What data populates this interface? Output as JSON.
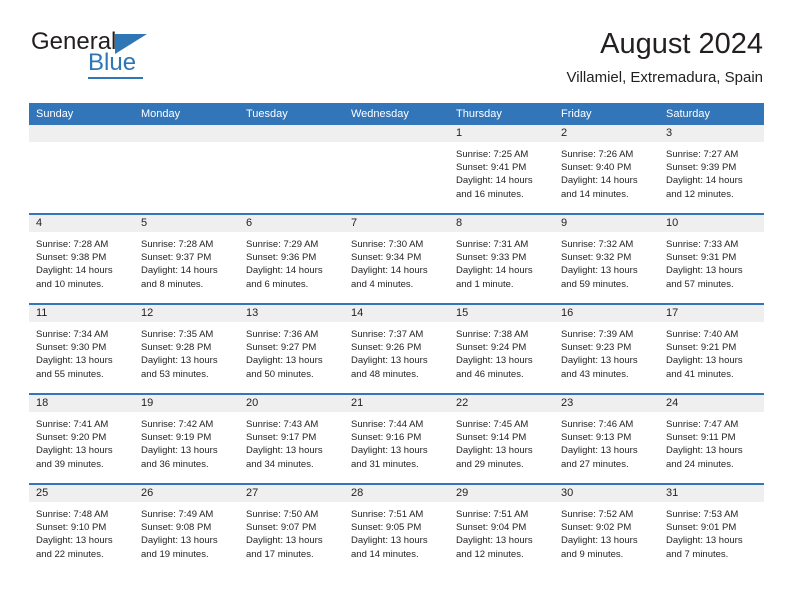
{
  "logo": {
    "word_top": "General",
    "word_bottom": "Blue",
    "brand_color": "#2f76b6",
    "triangle_icon": "triangle-icon"
  },
  "header": {
    "title": "August 2024",
    "subtitle": "Villamiel, Extremadura, Spain"
  },
  "theme": {
    "header_blue": "#3275b8",
    "daynum_gray": "#efefef",
    "text": "#231f20"
  },
  "weekday_headers": [
    "Sunday",
    "Monday",
    "Tuesday",
    "Wednesday",
    "Thursday",
    "Friday",
    "Saturday"
  ],
  "labels": {
    "sunrise": "Sunrise:",
    "sunset": "Sunset:",
    "daylight": "Daylight:"
  },
  "weeks": [
    [
      {
        "day": "",
        "blank": true,
        "sunrise": "",
        "sunset": "",
        "daylight_1": "",
        "daylight_2": ""
      },
      {
        "day": "",
        "blank": true,
        "sunrise": "",
        "sunset": "",
        "daylight_1": "",
        "daylight_2": ""
      },
      {
        "day": "",
        "blank": true,
        "sunrise": "",
        "sunset": "",
        "daylight_1": "",
        "daylight_2": ""
      },
      {
        "day": "",
        "blank": true,
        "sunrise": "",
        "sunset": "",
        "daylight_1": "",
        "daylight_2": ""
      },
      {
        "day": "1",
        "blank": false,
        "sunrise": "Sunrise: 7:25 AM",
        "sunset": "Sunset: 9:41 PM",
        "daylight_1": "Daylight: 14 hours",
        "daylight_2": "and 16 minutes."
      },
      {
        "day": "2",
        "blank": false,
        "sunrise": "Sunrise: 7:26 AM",
        "sunset": "Sunset: 9:40 PM",
        "daylight_1": "Daylight: 14 hours",
        "daylight_2": "and 14 minutes."
      },
      {
        "day": "3",
        "blank": false,
        "sunrise": "Sunrise: 7:27 AM",
        "sunset": "Sunset: 9:39 PM",
        "daylight_1": "Daylight: 14 hours",
        "daylight_2": "and 12 minutes."
      }
    ],
    [
      {
        "day": "4",
        "blank": false,
        "sunrise": "Sunrise: 7:28 AM",
        "sunset": "Sunset: 9:38 PM",
        "daylight_1": "Daylight: 14 hours",
        "daylight_2": "and 10 minutes."
      },
      {
        "day": "5",
        "blank": false,
        "sunrise": "Sunrise: 7:28 AM",
        "sunset": "Sunset: 9:37 PM",
        "daylight_1": "Daylight: 14 hours",
        "daylight_2": "and 8 minutes."
      },
      {
        "day": "6",
        "blank": false,
        "sunrise": "Sunrise: 7:29 AM",
        "sunset": "Sunset: 9:36 PM",
        "daylight_1": "Daylight: 14 hours",
        "daylight_2": "and 6 minutes."
      },
      {
        "day": "7",
        "blank": false,
        "sunrise": "Sunrise: 7:30 AM",
        "sunset": "Sunset: 9:34 PM",
        "daylight_1": "Daylight: 14 hours",
        "daylight_2": "and 4 minutes."
      },
      {
        "day": "8",
        "blank": false,
        "sunrise": "Sunrise: 7:31 AM",
        "sunset": "Sunset: 9:33 PM",
        "daylight_1": "Daylight: 14 hours",
        "daylight_2": "and 1 minute."
      },
      {
        "day": "9",
        "blank": false,
        "sunrise": "Sunrise: 7:32 AM",
        "sunset": "Sunset: 9:32 PM",
        "daylight_1": "Daylight: 13 hours",
        "daylight_2": "and 59 minutes."
      },
      {
        "day": "10",
        "blank": false,
        "sunrise": "Sunrise: 7:33 AM",
        "sunset": "Sunset: 9:31 PM",
        "daylight_1": "Daylight: 13 hours",
        "daylight_2": "and 57 minutes."
      }
    ],
    [
      {
        "day": "11",
        "blank": false,
        "sunrise": "Sunrise: 7:34 AM",
        "sunset": "Sunset: 9:30 PM",
        "daylight_1": "Daylight: 13 hours",
        "daylight_2": "and 55 minutes."
      },
      {
        "day": "12",
        "blank": false,
        "sunrise": "Sunrise: 7:35 AM",
        "sunset": "Sunset: 9:28 PM",
        "daylight_1": "Daylight: 13 hours",
        "daylight_2": "and 53 minutes."
      },
      {
        "day": "13",
        "blank": false,
        "sunrise": "Sunrise: 7:36 AM",
        "sunset": "Sunset: 9:27 PM",
        "daylight_1": "Daylight: 13 hours",
        "daylight_2": "and 50 minutes."
      },
      {
        "day": "14",
        "blank": false,
        "sunrise": "Sunrise: 7:37 AM",
        "sunset": "Sunset: 9:26 PM",
        "daylight_1": "Daylight: 13 hours",
        "daylight_2": "and 48 minutes."
      },
      {
        "day": "15",
        "blank": false,
        "sunrise": "Sunrise: 7:38 AM",
        "sunset": "Sunset: 9:24 PM",
        "daylight_1": "Daylight: 13 hours",
        "daylight_2": "and 46 minutes."
      },
      {
        "day": "16",
        "blank": false,
        "sunrise": "Sunrise: 7:39 AM",
        "sunset": "Sunset: 9:23 PM",
        "daylight_1": "Daylight: 13 hours",
        "daylight_2": "and 43 minutes."
      },
      {
        "day": "17",
        "blank": false,
        "sunrise": "Sunrise: 7:40 AM",
        "sunset": "Sunset: 9:21 PM",
        "daylight_1": "Daylight: 13 hours",
        "daylight_2": "and 41 minutes."
      }
    ],
    [
      {
        "day": "18",
        "blank": false,
        "sunrise": "Sunrise: 7:41 AM",
        "sunset": "Sunset: 9:20 PM",
        "daylight_1": "Daylight: 13 hours",
        "daylight_2": "and 39 minutes."
      },
      {
        "day": "19",
        "blank": false,
        "sunrise": "Sunrise: 7:42 AM",
        "sunset": "Sunset: 9:19 PM",
        "daylight_1": "Daylight: 13 hours",
        "daylight_2": "and 36 minutes."
      },
      {
        "day": "20",
        "blank": false,
        "sunrise": "Sunrise: 7:43 AM",
        "sunset": "Sunset: 9:17 PM",
        "daylight_1": "Daylight: 13 hours",
        "daylight_2": "and 34 minutes."
      },
      {
        "day": "21",
        "blank": false,
        "sunrise": "Sunrise: 7:44 AM",
        "sunset": "Sunset: 9:16 PM",
        "daylight_1": "Daylight: 13 hours",
        "daylight_2": "and 31 minutes."
      },
      {
        "day": "22",
        "blank": false,
        "sunrise": "Sunrise: 7:45 AM",
        "sunset": "Sunset: 9:14 PM",
        "daylight_1": "Daylight: 13 hours",
        "daylight_2": "and 29 minutes."
      },
      {
        "day": "23",
        "blank": false,
        "sunrise": "Sunrise: 7:46 AM",
        "sunset": "Sunset: 9:13 PM",
        "daylight_1": "Daylight: 13 hours",
        "daylight_2": "and 27 minutes."
      },
      {
        "day": "24",
        "blank": false,
        "sunrise": "Sunrise: 7:47 AM",
        "sunset": "Sunset: 9:11 PM",
        "daylight_1": "Daylight: 13 hours",
        "daylight_2": "and 24 minutes."
      }
    ],
    [
      {
        "day": "25",
        "blank": false,
        "sunrise": "Sunrise: 7:48 AM",
        "sunset": "Sunset: 9:10 PM",
        "daylight_1": "Daylight: 13 hours",
        "daylight_2": "and 22 minutes."
      },
      {
        "day": "26",
        "blank": false,
        "sunrise": "Sunrise: 7:49 AM",
        "sunset": "Sunset: 9:08 PM",
        "daylight_1": "Daylight: 13 hours",
        "daylight_2": "and 19 minutes."
      },
      {
        "day": "27",
        "blank": false,
        "sunrise": "Sunrise: 7:50 AM",
        "sunset": "Sunset: 9:07 PM",
        "daylight_1": "Daylight: 13 hours",
        "daylight_2": "and 17 minutes."
      },
      {
        "day": "28",
        "blank": false,
        "sunrise": "Sunrise: 7:51 AM",
        "sunset": "Sunset: 9:05 PM",
        "daylight_1": "Daylight: 13 hours",
        "daylight_2": "and 14 minutes."
      },
      {
        "day": "29",
        "blank": false,
        "sunrise": "Sunrise: 7:51 AM",
        "sunset": "Sunset: 9:04 PM",
        "daylight_1": "Daylight: 13 hours",
        "daylight_2": "and 12 minutes."
      },
      {
        "day": "30",
        "blank": false,
        "sunrise": "Sunrise: 7:52 AM",
        "sunset": "Sunset: 9:02 PM",
        "daylight_1": "Daylight: 13 hours",
        "daylight_2": "and 9 minutes."
      },
      {
        "day": "31",
        "blank": false,
        "sunrise": "Sunrise: 7:53 AM",
        "sunset": "Sunset: 9:01 PM",
        "daylight_1": "Daylight: 13 hours",
        "daylight_2": "and 7 minutes."
      }
    ]
  ]
}
